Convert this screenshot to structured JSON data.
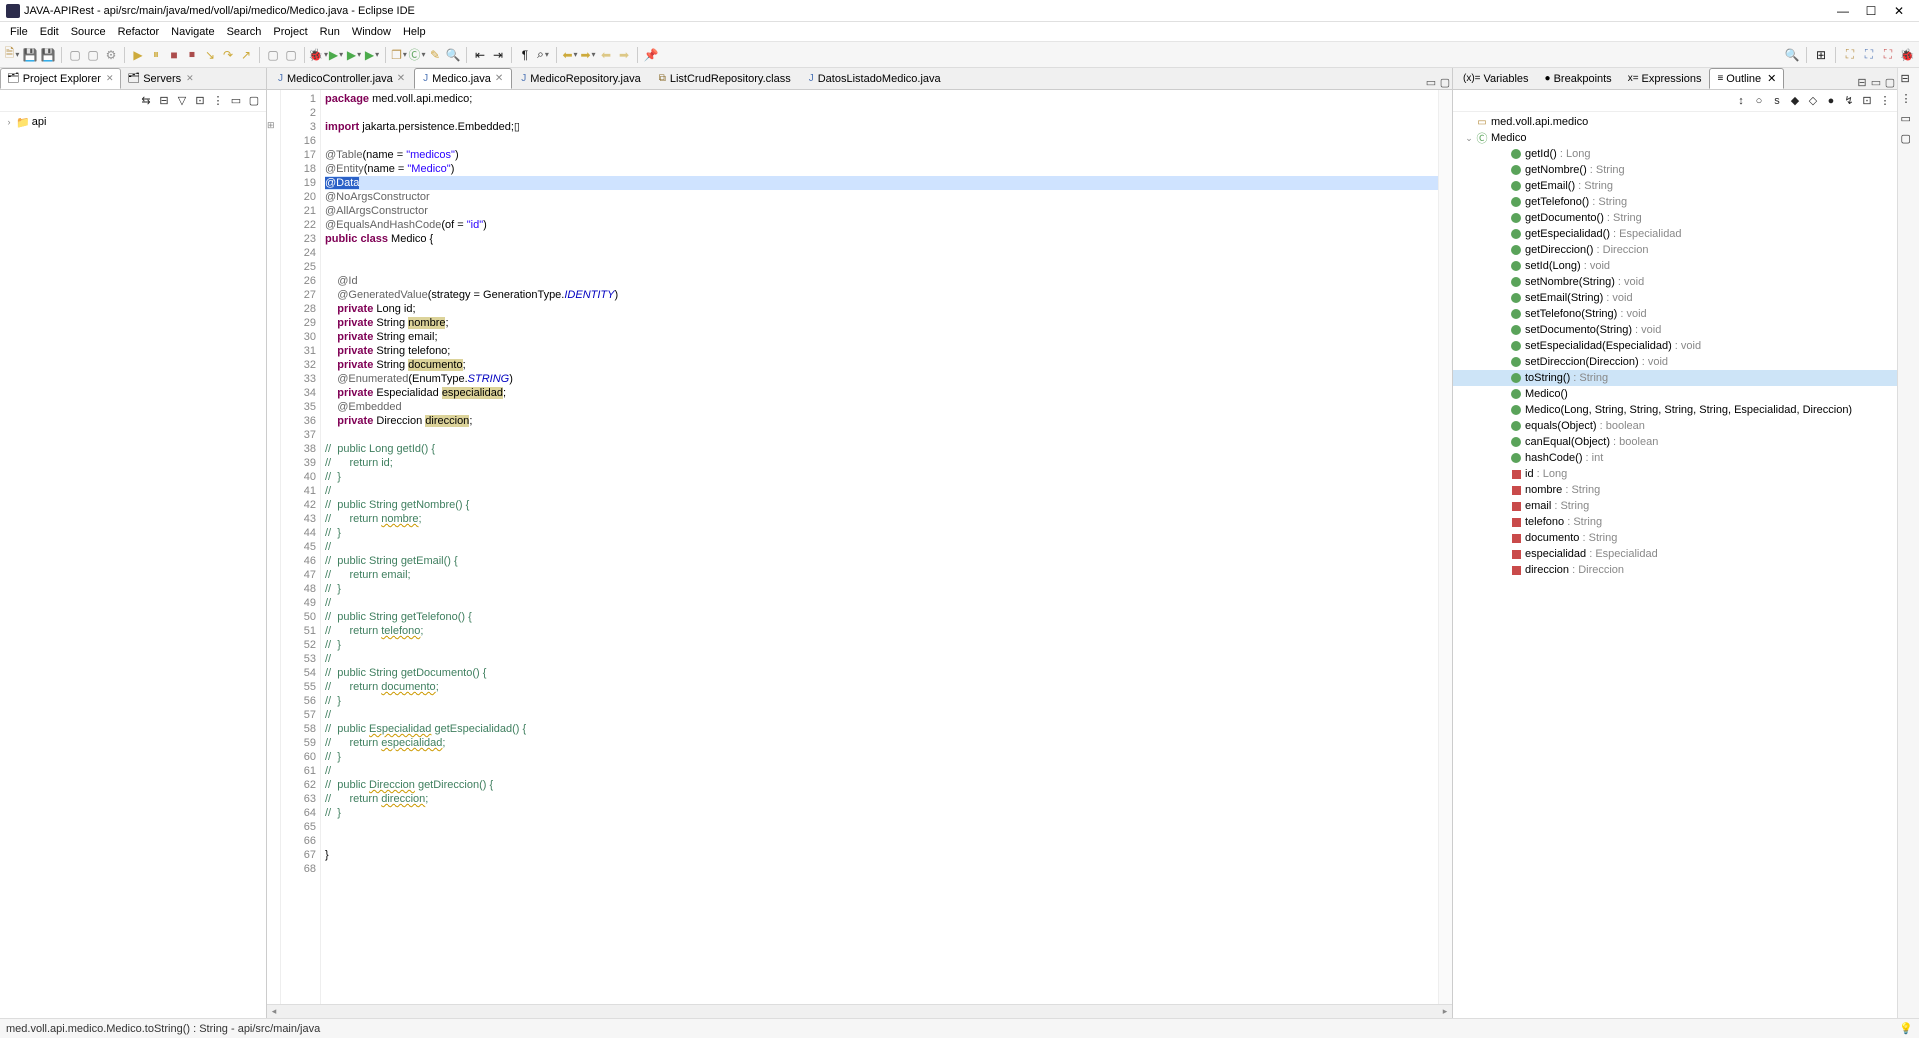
{
  "title": "JAVA-APIRest - api/src/main/java/med/voll/api/medico/Medico.java - Eclipse IDE",
  "menus": [
    "File",
    "Edit",
    "Source",
    "Refactor",
    "Navigate",
    "Search",
    "Project",
    "Run",
    "Window",
    "Help"
  ],
  "left": {
    "tabs": [
      {
        "label": "Project Explorer",
        "active": true
      },
      {
        "label": "Servers",
        "active": false
      }
    ],
    "tree": {
      "root": "api"
    }
  },
  "editor": {
    "tabs": [
      {
        "label": "MedicoController.java",
        "icon": "j",
        "active": false,
        "closable": true
      },
      {
        "label": "Medico.java",
        "icon": "j",
        "active": true,
        "closable": true
      },
      {
        "label": "MedicoRepository.java",
        "icon": "j",
        "active": false,
        "closable": false
      },
      {
        "label": "ListCrudRepository.class",
        "icon": "c",
        "active": false,
        "closable": false
      },
      {
        "label": "DatosListadoMedico.java",
        "icon": "j",
        "active": false,
        "closable": false
      }
    ],
    "lines": [
      {
        "n": 1,
        "t": "package med.voll.api.medico;",
        "seg": [
          [
            "kw",
            "package"
          ],
          [
            "",
            " med.voll.api.medico;"
          ]
        ]
      },
      {
        "n": 2,
        "t": ""
      },
      {
        "n": 3,
        "t": "import jakarta.persistence.Embedded;",
        "fold": true,
        "seg": [
          [
            "kw",
            "import"
          ],
          [
            "",
            " jakarta.persistence.Embedded;▯"
          ]
        ]
      },
      {
        "n": 16,
        "t": ""
      },
      {
        "n": 17,
        "t": "@Table(name = \"medicos\")",
        "seg": [
          [
            "ann",
            "@Table"
          ],
          [
            "",
            "(name = "
          ],
          [
            "str",
            "\"medicos\""
          ],
          [
            "",
            ")"
          ]
        ]
      },
      {
        "n": 18,
        "t": "@Entity(name = \"Medico\")",
        "seg": [
          [
            "ann",
            "@Entity"
          ],
          [
            "",
            "(name = "
          ],
          [
            "str",
            "\"Medico\""
          ],
          [
            "",
            ")"
          ]
        ]
      },
      {
        "n": 19,
        "t": "@Data",
        "hl": true,
        "selText": "@Data"
      },
      {
        "n": 20,
        "t": "@NoArgsConstructor",
        "seg": [
          [
            "ann",
            "@NoArgsConstructor"
          ]
        ]
      },
      {
        "n": 21,
        "t": "@AllArgsConstructor",
        "seg": [
          [
            "ann",
            "@AllArgsConstructor"
          ]
        ]
      },
      {
        "n": 22,
        "t": "@EqualsAndHashCode(of = \"id\")",
        "seg": [
          [
            "ann",
            "@EqualsAndHashCode"
          ],
          [
            "",
            "(of = "
          ],
          [
            "str",
            "\"id\""
          ],
          [
            "",
            ")"
          ]
        ]
      },
      {
        "n": 23,
        "t": "public class Medico {",
        "seg": [
          [
            "kw",
            "public class"
          ],
          [
            "",
            " Medico {"
          ]
        ]
      },
      {
        "n": 24,
        "t": ""
      },
      {
        "n": 25,
        "t": ""
      },
      {
        "n": 26,
        "t": "    @Id",
        "seg": [
          [
            "",
            "    "
          ],
          [
            "ann",
            "@Id"
          ]
        ]
      },
      {
        "n": 27,
        "t": "    @GeneratedValue(strategy = GenerationType.IDENTITY)",
        "seg": [
          [
            "",
            "    "
          ],
          [
            "ann",
            "@GeneratedValue"
          ],
          [
            "",
            "(strategy = GenerationType."
          ],
          [
            "itl",
            "IDENTITY"
          ],
          [
            "",
            ")"
          ]
        ]
      },
      {
        "n": 28,
        "t": "    private Long id;",
        "seg": [
          [
            "",
            "    "
          ],
          [
            "kw",
            "private"
          ],
          [
            "",
            " Long id;"
          ]
        ]
      },
      {
        "n": 29,
        "t": "    private String nombre;",
        "seg": [
          [
            "",
            "    "
          ],
          [
            "kw",
            "private"
          ],
          [
            "",
            " String "
          ],
          [
            "occ",
            "nombre"
          ],
          [
            "",
            ";"
          ]
        ]
      },
      {
        "n": 30,
        "t": "    private String email;",
        "seg": [
          [
            "",
            "    "
          ],
          [
            "kw",
            "private"
          ],
          [
            "",
            " String email;"
          ]
        ]
      },
      {
        "n": 31,
        "t": "    private String telefono;",
        "seg": [
          [
            "",
            "    "
          ],
          [
            "kw",
            "private"
          ],
          [
            "",
            " String telefono;"
          ]
        ]
      },
      {
        "n": 32,
        "t": "    private String documento;",
        "seg": [
          [
            "",
            "    "
          ],
          [
            "kw",
            "private"
          ],
          [
            "",
            " String "
          ],
          [
            "occ",
            "documento"
          ],
          [
            "",
            ";"
          ]
        ]
      },
      {
        "n": 33,
        "t": "    @Enumerated(EnumType.STRING)",
        "seg": [
          [
            "",
            "    "
          ],
          [
            "ann",
            "@Enumerated"
          ],
          [
            "",
            "(EnumType."
          ],
          [
            "itl",
            "STRING"
          ],
          [
            "",
            ")"
          ]
        ]
      },
      {
        "n": 34,
        "t": "    private Especialidad especialidad;",
        "seg": [
          [
            "",
            "    "
          ],
          [
            "kw",
            "private"
          ],
          [
            "",
            " Especialidad "
          ],
          [
            "occ",
            "especialidad"
          ],
          [
            "",
            ";"
          ]
        ]
      },
      {
        "n": 35,
        "t": "    @Embedded",
        "seg": [
          [
            "",
            "    "
          ],
          [
            "ann",
            "@Embedded"
          ]
        ]
      },
      {
        "n": 36,
        "t": "    private Direccion direccion;",
        "seg": [
          [
            "",
            "    "
          ],
          [
            "kw",
            "private"
          ],
          [
            "",
            " Direccion "
          ],
          [
            "occ",
            "direccion"
          ],
          [
            "",
            ";"
          ]
        ]
      },
      {
        "n": 37,
        "t": ""
      },
      {
        "n": 38,
        "t": "//  public Long getId() {",
        "cmt": true
      },
      {
        "n": 39,
        "t": "//      return id;",
        "cmt": true
      },
      {
        "n": 40,
        "t": "//  }",
        "cmt": true
      },
      {
        "n": 41,
        "t": "//",
        "cmt": true
      },
      {
        "n": 42,
        "t": "//  public String getNombre() {",
        "cmt": true
      },
      {
        "n": 43,
        "t": "//      return nombre;",
        "cmt": true,
        "und": "nombre"
      },
      {
        "n": 44,
        "t": "//  }",
        "cmt": true
      },
      {
        "n": 45,
        "t": "//",
        "cmt": true
      },
      {
        "n": 46,
        "t": "//  public String getEmail() {",
        "cmt": true
      },
      {
        "n": 47,
        "t": "//      return email;",
        "cmt": true
      },
      {
        "n": 48,
        "t": "//  }",
        "cmt": true
      },
      {
        "n": 49,
        "t": "//",
        "cmt": true
      },
      {
        "n": 50,
        "t": "//  public String getTelefono() {",
        "cmt": true
      },
      {
        "n": 51,
        "t": "//      return telefono;",
        "cmt": true,
        "und": "telefono"
      },
      {
        "n": 52,
        "t": "//  }",
        "cmt": true
      },
      {
        "n": 53,
        "t": "//",
        "cmt": true
      },
      {
        "n": 54,
        "t": "//  public String getDocumento() {",
        "cmt": true
      },
      {
        "n": 55,
        "t": "//      return documento;",
        "cmt": true,
        "und": "documento"
      },
      {
        "n": 56,
        "t": "//  }",
        "cmt": true
      },
      {
        "n": 57,
        "t": "//",
        "cmt": true
      },
      {
        "n": 58,
        "t": "//  public Especialidad getEspecialidad() {",
        "cmt": true,
        "und": "Especialidad"
      },
      {
        "n": 59,
        "t": "//      return especialidad;",
        "cmt": true,
        "und": "especialidad"
      },
      {
        "n": 60,
        "t": "//  }",
        "cmt": true
      },
      {
        "n": 61,
        "t": "//",
        "cmt": true
      },
      {
        "n": 62,
        "t": "//  public Direccion getDireccion() {",
        "cmt": true,
        "und": "Direccion"
      },
      {
        "n": 63,
        "t": "//      return direccion;",
        "cmt": true,
        "und": "direccion"
      },
      {
        "n": 64,
        "t": "//  }",
        "cmt": true
      },
      {
        "n": 65,
        "t": ""
      },
      {
        "n": 66,
        "t": ""
      },
      {
        "n": 67,
        "t": "}"
      },
      {
        "n": 68,
        "t": ""
      }
    ]
  },
  "right": {
    "tabs": [
      {
        "label": "Variables",
        "icon": "(x)="
      },
      {
        "label": "Breakpoints",
        "icon": "●"
      },
      {
        "label": "Expressions",
        "icon": "x="
      },
      {
        "label": "Outline",
        "icon": "≡",
        "active": true,
        "closable": true
      }
    ],
    "pkg": "med.voll.api.medico",
    "class": "Medico",
    "members": [
      {
        "k": "m",
        "name": "getId()",
        "ret": "Long"
      },
      {
        "k": "m",
        "name": "getNombre()",
        "ret": "String"
      },
      {
        "k": "m",
        "name": "getEmail()",
        "ret": "String"
      },
      {
        "k": "m",
        "name": "getTelefono()",
        "ret": "String"
      },
      {
        "k": "m",
        "name": "getDocumento()",
        "ret": "String"
      },
      {
        "k": "m",
        "name": "getEspecialidad()",
        "ret": "Especialidad"
      },
      {
        "k": "m",
        "name": "getDireccion()",
        "ret": "Direccion"
      },
      {
        "k": "m",
        "name": "setId(Long)",
        "ret": "void"
      },
      {
        "k": "m",
        "name": "setNombre(String)",
        "ret": "void"
      },
      {
        "k": "m",
        "name": "setEmail(String)",
        "ret": "void"
      },
      {
        "k": "m",
        "name": "setTelefono(String)",
        "ret": "void"
      },
      {
        "k": "m",
        "name": "setDocumento(String)",
        "ret": "void"
      },
      {
        "k": "m",
        "name": "setEspecialidad(Especialidad)",
        "ret": "void"
      },
      {
        "k": "m",
        "name": "setDireccion(Direccion)",
        "ret": "void"
      },
      {
        "k": "m",
        "name": "toString()",
        "ret": "String",
        "sel": true
      },
      {
        "k": "c",
        "name": "Medico()"
      },
      {
        "k": "c",
        "name": "Medico(Long, String, String, String, String, Especialidad, Direccion)"
      },
      {
        "k": "m",
        "name": "equals(Object)",
        "ret": "boolean"
      },
      {
        "k": "m",
        "name": "canEqual(Object)",
        "ret": "boolean"
      },
      {
        "k": "m",
        "name": "hashCode()",
        "ret": "int"
      },
      {
        "k": "f",
        "name": "id",
        "ret": "Long"
      },
      {
        "k": "f",
        "name": "nombre",
        "ret": "String"
      },
      {
        "k": "f",
        "name": "email",
        "ret": "String"
      },
      {
        "k": "f",
        "name": "telefono",
        "ret": "String"
      },
      {
        "k": "f",
        "name": "documento",
        "ret": "String"
      },
      {
        "k": "f",
        "name": "especialidad",
        "ret": "Especialidad"
      },
      {
        "k": "f",
        "name": "direccion",
        "ret": "Direccion"
      }
    ]
  },
  "status": "med.voll.api.medico.Medico.toString() : String - api/src/main/java"
}
